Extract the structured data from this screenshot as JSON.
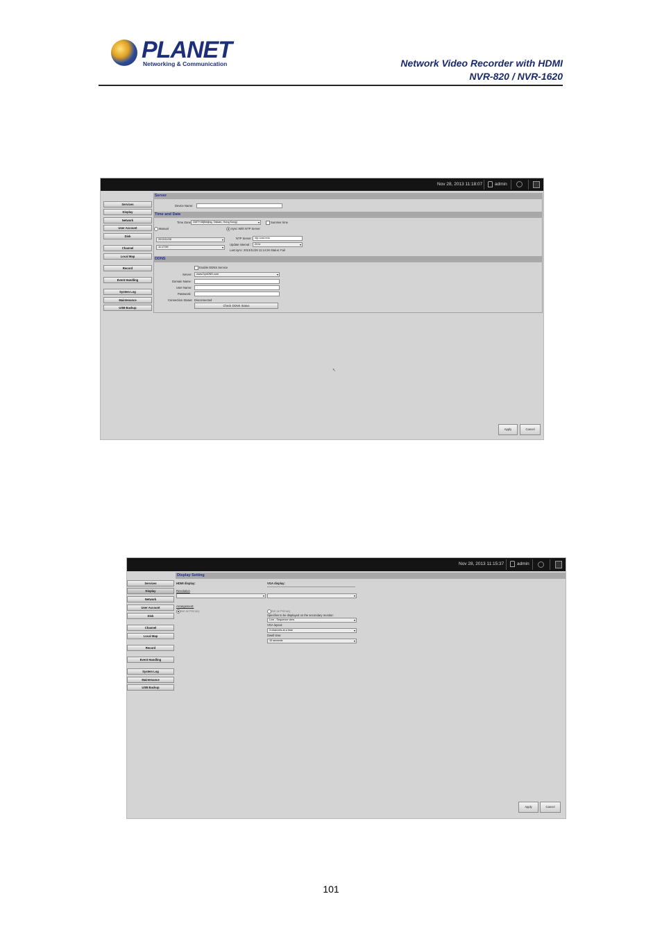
{
  "header": {
    "logo_text": "PLANET",
    "logo_sub": "Networking & Communication",
    "title_line1": "Network Video Recorder with HDMI",
    "title_line2": "NVR-820 / NVR-1620"
  },
  "page_number": "101",
  "shot1": {
    "datetime": "Nov 28, 2013 11:18:07",
    "user": "admin",
    "nav": [
      "Services",
      "Display",
      "Network",
      "User Account",
      "Disk",
      "Channel",
      "Local Map",
      "Record",
      "Event Handling",
      "System Log",
      "Maintenance",
      "USB Backup"
    ],
    "server": {
      "section": "Server",
      "device_name_label": "Device Name:"
    },
    "time": {
      "section": "Time and Date",
      "timezone_label": "Time Zone:",
      "timezone_value": "GMT+08(Beijing, Taiwan, Hong Kong)",
      "summer_label": "Summer time",
      "manual_label": "Manual",
      "ntp_sync_label": "Sync With NTP Server",
      "date_value": "2013/11/28",
      "time_value": "11:17:59",
      "ntp_server_label": "NTP Server :",
      "ntp_server_value": "ntp.ucsd.edu",
      "update_label": "Update interval :",
      "update_value": "24 hr",
      "last_sync": "Last sync: 2013/11/28 11:14:26 Status: Fail"
    },
    "ddns": {
      "section": "DDNS",
      "enable_label": "Enable DDNS Service",
      "server_label": "Server:",
      "server_value": "www.DynDNS.com",
      "domain_label": "Domain Name:",
      "user_label": "User Name:",
      "password_label": "Password:",
      "status_label": "Connection Status:",
      "status_value": "Disconnected",
      "check_button": "Check DDNS Status"
    },
    "apply": "Apply",
    "cancel": "Cancel"
  },
  "shot2": {
    "datetime": "Nov 28, 2013 11:15:37",
    "user": "admin",
    "nav": [
      "Services",
      "Display",
      "Network",
      "User Account",
      "Disk",
      "Channel",
      "Local Map",
      "Record",
      "Event Handling",
      "System Log",
      "Maintenance",
      "USB Backup"
    ],
    "section": "Display Setting",
    "hdmi_label": "HDMI display:",
    "vga_label": "VGA display:",
    "resolution_label": "Resolution",
    "arrangement_label": "Arrangement:",
    "set_primary_left": "Set as Primary",
    "set_primary_right": "Set as Primary",
    "seq_label": "Specifies to be displayed on the secondary monitor:",
    "seq_value": "Live - Sequence view",
    "vga_layout_label": "VGA layout:",
    "vga_layout_value": "3 channels at a time",
    "dwell_label": "Dwell time:",
    "dwell_value": "10 seconds",
    "apply": "Apply",
    "cancel": "Cancel"
  }
}
